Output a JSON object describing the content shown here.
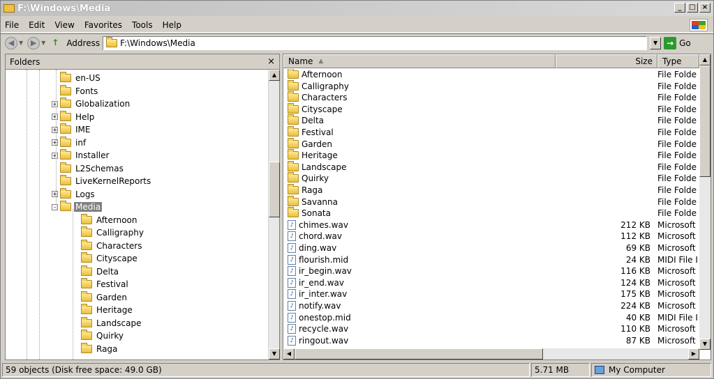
{
  "window": {
    "title": "F:\\Windows\\Media"
  },
  "menu": [
    {
      "label": "File"
    },
    {
      "label": "Edit"
    },
    {
      "label": "View"
    },
    {
      "label": "Favorites"
    },
    {
      "label": "Tools"
    },
    {
      "label": "Help"
    }
  ],
  "address": {
    "label": "Address",
    "value": "F:\\Windows\\Media",
    "go_label": "Go"
  },
  "folders_pane": {
    "title": "Folders",
    "close_glyph": "×",
    "tree": [
      {
        "label": "en-US",
        "expander": ""
      },
      {
        "label": "Fonts",
        "expander": ""
      },
      {
        "label": "Globalization",
        "expander": "+"
      },
      {
        "label": "Help",
        "expander": "+"
      },
      {
        "label": "IME",
        "expander": "+"
      },
      {
        "label": "inf",
        "expander": "+"
      },
      {
        "label": "Installer",
        "expander": "+"
      },
      {
        "label": "L2Schemas",
        "expander": ""
      },
      {
        "label": "LiveKernelReports",
        "expander": ""
      },
      {
        "label": "Logs",
        "expander": "+"
      },
      {
        "label": "Media",
        "expander": "-",
        "selected": true
      },
      {
        "label": "Afternoon",
        "expander": "",
        "child": true
      },
      {
        "label": "Calligraphy",
        "expander": "",
        "child": true
      },
      {
        "label": "Characters",
        "expander": "",
        "child": true
      },
      {
        "label": "Cityscape",
        "expander": "",
        "child": true
      },
      {
        "label": "Delta",
        "expander": "",
        "child": true
      },
      {
        "label": "Festival",
        "expander": "",
        "child": true
      },
      {
        "label": "Garden",
        "expander": "",
        "child": true
      },
      {
        "label": "Heritage",
        "expander": "",
        "child": true
      },
      {
        "label": "Landscape",
        "expander": "",
        "child": true
      },
      {
        "label": "Quirky",
        "expander": "",
        "child": true
      },
      {
        "label": "Raga",
        "expander": "",
        "child": true
      }
    ]
  },
  "list": {
    "columns": [
      {
        "label": "Name"
      },
      {
        "label": "Size"
      },
      {
        "label": "Type"
      }
    ],
    "rows": [
      {
        "name": "Afternoon",
        "size": "",
        "type": "File Folde",
        "kind": "folder"
      },
      {
        "name": "Calligraphy",
        "size": "",
        "type": "File Folde",
        "kind": "folder"
      },
      {
        "name": "Characters",
        "size": "",
        "type": "File Folde",
        "kind": "folder"
      },
      {
        "name": "Cityscape",
        "size": "",
        "type": "File Folde",
        "kind": "folder"
      },
      {
        "name": "Delta",
        "size": "",
        "type": "File Folde",
        "kind": "folder"
      },
      {
        "name": "Festival",
        "size": "",
        "type": "File Folde",
        "kind": "folder"
      },
      {
        "name": "Garden",
        "size": "",
        "type": "File Folde",
        "kind": "folder"
      },
      {
        "name": "Heritage",
        "size": "",
        "type": "File Folde",
        "kind": "folder"
      },
      {
        "name": "Landscape",
        "size": "",
        "type": "File Folde",
        "kind": "folder"
      },
      {
        "name": "Quirky",
        "size": "",
        "type": "File Folde",
        "kind": "folder"
      },
      {
        "name": "Raga",
        "size": "",
        "type": "File Folde",
        "kind": "folder"
      },
      {
        "name": "Savanna",
        "size": "",
        "type": "File Folde",
        "kind": "folder"
      },
      {
        "name": "Sonata",
        "size": "",
        "type": "File Folde",
        "kind": "folder"
      },
      {
        "name": "chimes.wav",
        "size": "212 KB",
        "type": "Microsoft",
        "kind": "file"
      },
      {
        "name": "chord.wav",
        "size": "112 KB",
        "type": "Microsoft",
        "kind": "file"
      },
      {
        "name": "ding.wav",
        "size": "69 KB",
        "type": "Microsoft",
        "kind": "file"
      },
      {
        "name": "flourish.mid",
        "size": "24 KB",
        "type": "MIDI File I",
        "kind": "file"
      },
      {
        "name": "ir_begin.wav",
        "size": "116 KB",
        "type": "Microsoft",
        "kind": "file"
      },
      {
        "name": "ir_end.wav",
        "size": "124 KB",
        "type": "Microsoft",
        "kind": "file"
      },
      {
        "name": "ir_inter.wav",
        "size": "175 KB",
        "type": "Microsoft",
        "kind": "file"
      },
      {
        "name": "notify.wav",
        "size": "224 KB",
        "type": "Microsoft",
        "kind": "file"
      },
      {
        "name": "onestop.mid",
        "size": "40 KB",
        "type": "MIDI File I",
        "kind": "file"
      },
      {
        "name": "recycle.wav",
        "size": "110 KB",
        "type": "Microsoft",
        "kind": "file"
      },
      {
        "name": "ringout.wav",
        "size": "87 KB",
        "type": "Microsoft",
        "kind": "file"
      }
    ]
  },
  "status": {
    "objects": "59 objects (Disk free space: 49.0 GB)",
    "size": "5.71 MB",
    "location": "My Computer"
  }
}
